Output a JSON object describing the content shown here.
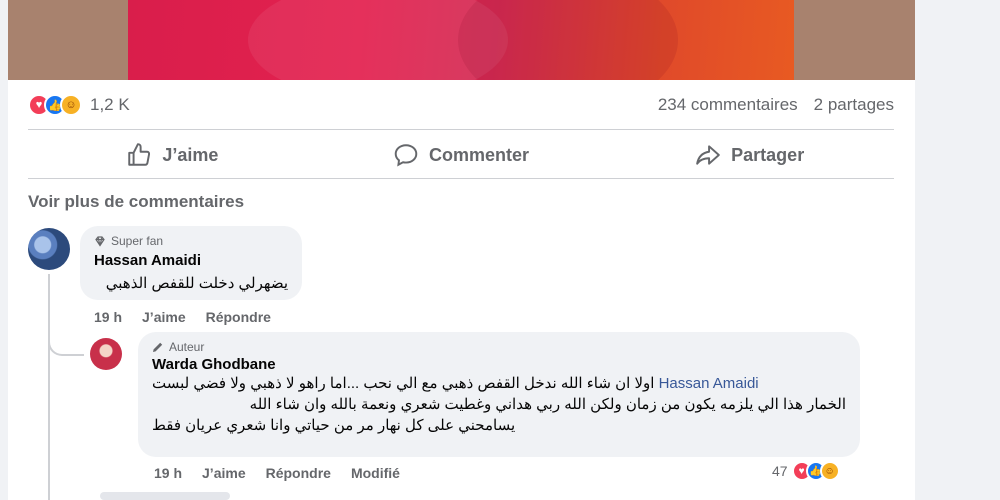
{
  "post": {
    "reactions_count": "1,2 K",
    "comments_count": "234 commentaires",
    "shares_count": "2 partages"
  },
  "actions": {
    "like": "J’aime",
    "comment": "Commenter",
    "share": "Partager"
  },
  "more_comments": "Voir plus de commentaires",
  "comments": [
    {
      "badge": "Super fan",
      "author": "Hassan Amaidi",
      "text": "يضهرلي دخلت للقفص الذهبي",
      "time": "19 h",
      "like_label": "J’aime",
      "reply_label": "Répondre"
    },
    {
      "badge": "Auteur",
      "author": "Warda Ghodbane",
      "mention": "Hassan Amaidi",
      "line1": "اولا ان شاء الله ندخل القفص ذهبي مع الي نحب ...اما راهو لا ذهبي ولا فضي لبست",
      "line2": "الخمار هذا الي يلزمه يكون من زمان ولكن الله ربي هداني وغطيت شعري ونعمة بالله وان شاء الله",
      "line3": "يسامحني على كل نهار مر من حياتي وانا شعري عريان فقط",
      "time": "19 h",
      "like_label": "J’aime",
      "reply_label": "Répondre",
      "edited_label": "Modifié",
      "reactions_count": "47"
    }
  ],
  "colors": {
    "love": "#f33e58",
    "like": "#1877f2",
    "care": "#f7b125"
  }
}
